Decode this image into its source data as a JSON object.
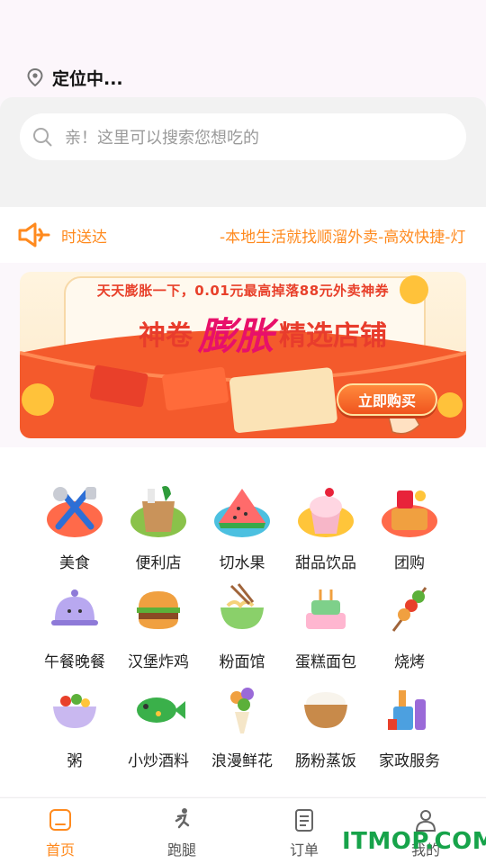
{
  "location": {
    "text": "定位中..."
  },
  "search": {
    "placeholder": "亲！这里可以搜索您想吃的"
  },
  "notice": {
    "text_a": "时送达",
    "text_b": "-本地生活就找顺溜外卖-高效快捷-灯"
  },
  "banner": {
    "subtitle": "天天膨胀一下，0.01元最高掉落88元外卖神券",
    "title_left": "神卷",
    "title_mid": "膨胀",
    "title_right": "精选店铺",
    "button": "立即购买"
  },
  "categories": [
    {
      "label": "美食",
      "icon": "cutlery-icon"
    },
    {
      "label": "便利店",
      "icon": "grocery-bag-icon"
    },
    {
      "label": "切水果",
      "icon": "watermelon-icon"
    },
    {
      "label": "甜品饮品",
      "icon": "cupcake-icon"
    },
    {
      "label": "团购",
      "icon": "gift-basket-icon"
    },
    {
      "label": "午餐晚餐",
      "icon": "food-cloche-icon"
    },
    {
      "label": "汉堡炸鸡",
      "icon": "burger-icon"
    },
    {
      "label": "粉面馆",
      "icon": "noodle-bowl-icon"
    },
    {
      "label": "蛋糕面包",
      "icon": "cake-icon"
    },
    {
      "label": "烧烤",
      "icon": "skewer-icon"
    },
    {
      "label": "粥",
      "icon": "porridge-bowl-icon"
    },
    {
      "label": "小炒酒料",
      "icon": "fish-icon"
    },
    {
      "label": "浪漫鲜花",
      "icon": "flower-bouquet-icon"
    },
    {
      "label": "肠粉蒸饭",
      "icon": "rice-bowl-icon"
    },
    {
      "label": "家政服务",
      "icon": "cleaning-tools-icon"
    }
  ],
  "tabs": [
    {
      "label": "首页",
      "icon": "home-icon"
    },
    {
      "label": "跑腿",
      "icon": "runner-icon"
    },
    {
      "label": "订单",
      "icon": "order-list-icon"
    },
    {
      "label": "我的",
      "icon": "user-icon"
    }
  ],
  "watermark": "ITMOP.COM",
  "colors": {
    "accent": "#ff8a1e",
    "watermark": "#17a34a"
  }
}
